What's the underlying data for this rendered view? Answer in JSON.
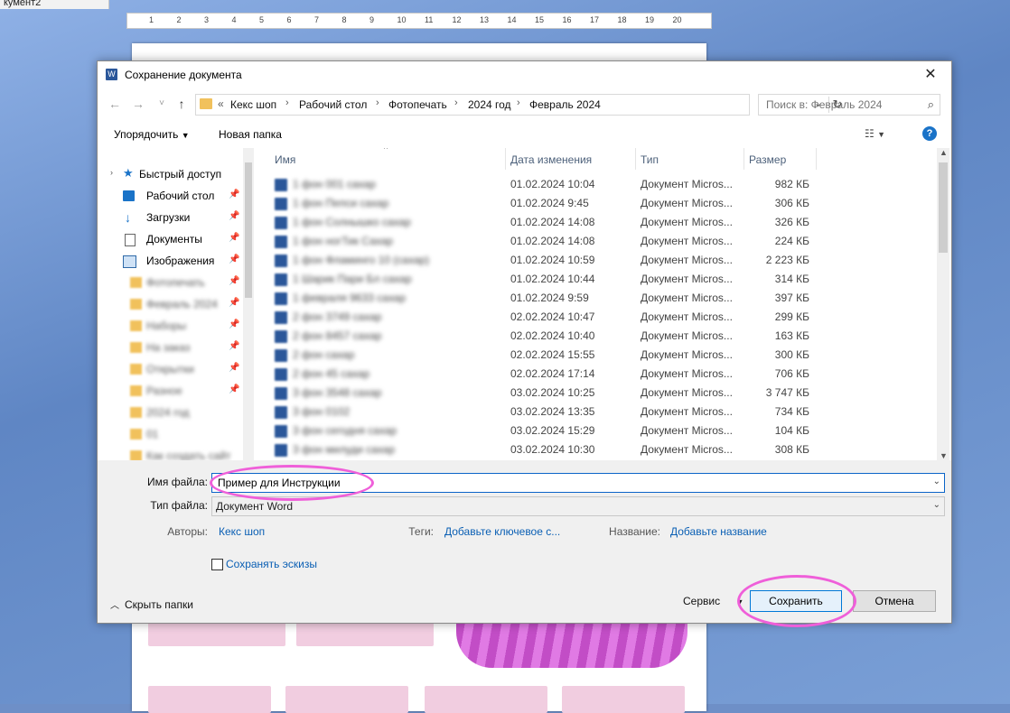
{
  "word": {
    "tab_label": "кумент2",
    "ruler_marks": [
      "1",
      "2",
      "3",
      "4",
      "5",
      "6",
      "7",
      "8",
      "9",
      "10",
      "11",
      "12",
      "13",
      "14",
      "15",
      "16",
      "17",
      "18",
      "19",
      "20"
    ]
  },
  "dialog": {
    "title": "Сохранение документа",
    "close_glyph": "✕",
    "nav": {
      "back": "←",
      "forward": "→",
      "recent": "˅",
      "up": "↑"
    },
    "address": {
      "overflow": "«",
      "crumbs": [
        "Кекс шоп",
        "Рабочий стол",
        "Фотопечать",
        "2024 год",
        "Февраль 2024"
      ]
    },
    "search": {
      "placeholder": "Поиск в: Февраль 2024"
    },
    "toolbar": {
      "organize": "Упорядочить",
      "new_folder": "Новая папка",
      "help": "?"
    },
    "nav_pane": {
      "quick_access": "Быстрый доступ",
      "items": [
        {
          "label": "Рабочий стол",
          "icon": "desktop-icon"
        },
        {
          "label": "Загрузки",
          "icon": "downloads-icon"
        },
        {
          "label": "Документы",
          "icon": "documents-icon"
        },
        {
          "label": "Изображения",
          "icon": "pictures-icon"
        }
      ],
      "blurred_folders": [
        "Фотопечать",
        "Февраль 2024",
        "Наборы",
        "На заказ",
        "Открытки",
        "Разное",
        "2024 год",
        "01",
        "Как создать сайт"
      ]
    },
    "columns": {
      "name": "Имя",
      "date": "Дата изменения",
      "type": "Тип",
      "size": "Размер"
    },
    "files": [
      {
        "name": "1 фон 001 сахар",
        "date": "01.02.2024 10:04",
        "type": "Документ Micros...",
        "size": "982 КБ"
      },
      {
        "name": "1 фон Пепси сахар",
        "date": "01.02.2024 9:45",
        "type": "Документ Micros...",
        "size": "306 КБ"
      },
      {
        "name": "1 фон Солнышко сахар",
        "date": "01.02.2024 14:08",
        "type": "Документ Micros...",
        "size": "326 КБ"
      },
      {
        "name": "1 фон ногТик Сахар",
        "date": "01.02.2024 14:08",
        "type": "Документ Micros...",
        "size": "224 КБ"
      },
      {
        "name": "1 фон Фламинго 10 (сахар)",
        "date": "01.02.2024 10:59",
        "type": "Документ Micros...",
        "size": "2 223 КБ"
      },
      {
        "name": "1 Шарик Пари Бл сахар",
        "date": "01.02.2024 10:44",
        "type": "Документ Micros...",
        "size": "314 КБ"
      },
      {
        "name": "1 февраля 9633 сахар",
        "date": "01.02.2024 9:59",
        "type": "Документ Micros...",
        "size": "397 КБ"
      },
      {
        "name": "2 фон 3749 сахар",
        "date": "02.02.2024 10:47",
        "type": "Документ Micros...",
        "size": "299 КБ"
      },
      {
        "name": "2 фон 8457 сахар",
        "date": "02.02.2024 10:40",
        "type": "Документ Micros...",
        "size": "163 КБ"
      },
      {
        "name": "2 фон сахар",
        "date": "02.02.2024 15:55",
        "type": "Документ Micros...",
        "size": "300 КБ"
      },
      {
        "name": "2 фон 45 сахар",
        "date": "02.02.2024 17:14",
        "type": "Документ Micros...",
        "size": "706 КБ"
      },
      {
        "name": "3 фон 3548 сахар",
        "date": "03.02.2024 10:25",
        "type": "Документ Micros...",
        "size": "3 747 КБ"
      },
      {
        "name": "3 фон 0102",
        "date": "03.02.2024 13:35",
        "type": "Документ Micros...",
        "size": "734 КБ"
      },
      {
        "name": "3 фон сегодня сахар",
        "date": "03.02.2024 15:29",
        "type": "Документ Micros...",
        "size": "104 КБ"
      },
      {
        "name": "3 фон милуди сахар",
        "date": "03.02.2024 10:30",
        "type": "Документ Micros...",
        "size": "308 КБ"
      }
    ],
    "form": {
      "filename_label": "Имя файла:",
      "filename_value": "Пример для Инструкции",
      "filetype_label": "Тип файла:",
      "filetype_value": "Документ Word",
      "authors_label": "Авторы:",
      "authors_value": "Кекс шоп",
      "tags_label": "Теги:",
      "tags_value": "Добавьте ключевое с...",
      "title_label": "Название:",
      "title_value": "Добавьте название",
      "thumbnails_label": "Сохранять эскизы"
    },
    "footer": {
      "hide_folders": "Скрыть папки",
      "service": "Сервис",
      "save": "Сохранить",
      "cancel": "Отмена"
    }
  },
  "colors": {
    "accent": "#0078d7",
    "link": "#0a5fb4",
    "annotation": "#ef5fd9"
  }
}
